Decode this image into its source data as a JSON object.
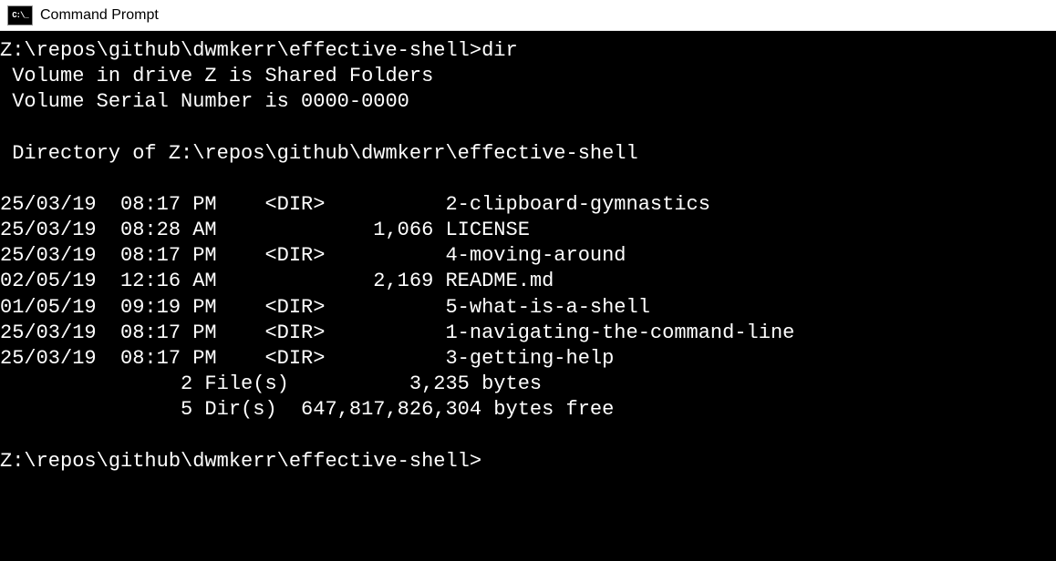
{
  "window": {
    "title": "Command Prompt",
    "icon_label": "C:\\_"
  },
  "terminal": {
    "prompt_path": "Z:\\repos\\github\\dwmkerr\\effective-shell>",
    "command": "dir",
    "volume_line": " Volume in drive Z is Shared Folders",
    "serial_line": " Volume Serial Number is 0000-0000",
    "blank": "",
    "directory_line": " Directory of Z:\\repos\\github\\dwmkerr\\effective-shell",
    "entries": [
      {
        "date": "25/03/19",
        "time": "08:17 PM",
        "type": "<DIR>",
        "size": "",
        "name": "2-clipboard-gymnastics"
      },
      {
        "date": "25/03/19",
        "time": "08:28 AM",
        "type": "",
        "size": "1,066",
        "name": "LICENSE"
      },
      {
        "date": "25/03/19",
        "time": "08:17 PM",
        "type": "<DIR>",
        "size": "",
        "name": "4-moving-around"
      },
      {
        "date": "02/05/19",
        "time": "12:16 AM",
        "type": "",
        "size": "2,169",
        "name": "README.md"
      },
      {
        "date": "01/05/19",
        "time": "09:19 PM",
        "type": "<DIR>",
        "size": "",
        "name": "5-what-is-a-shell"
      },
      {
        "date": "25/03/19",
        "time": "08:17 PM",
        "type": "<DIR>",
        "size": "",
        "name": "1-navigating-the-command-line"
      },
      {
        "date": "25/03/19",
        "time": "08:17 PM",
        "type": "<DIR>",
        "size": "",
        "name": "3-getting-help"
      }
    ],
    "summary_files": "               2 File(s)          3,235 bytes",
    "summary_dirs": "               5 Dir(s)  647,817,826,304 bytes free",
    "row0": "25/03/19  08:17 PM    <DIR>          2-clipboard-gymnastics",
    "row1": "25/03/19  08:28 AM             1,066 LICENSE",
    "row2": "25/03/19  08:17 PM    <DIR>          4-moving-around",
    "row3": "02/05/19  12:16 AM             2,169 README.md",
    "row4": "01/05/19  09:19 PM    <DIR>          5-what-is-a-shell",
    "row5": "25/03/19  08:17 PM    <DIR>          1-navigating-the-command-line",
    "row6": "25/03/19  08:17 PM    <DIR>          3-getting-help"
  }
}
